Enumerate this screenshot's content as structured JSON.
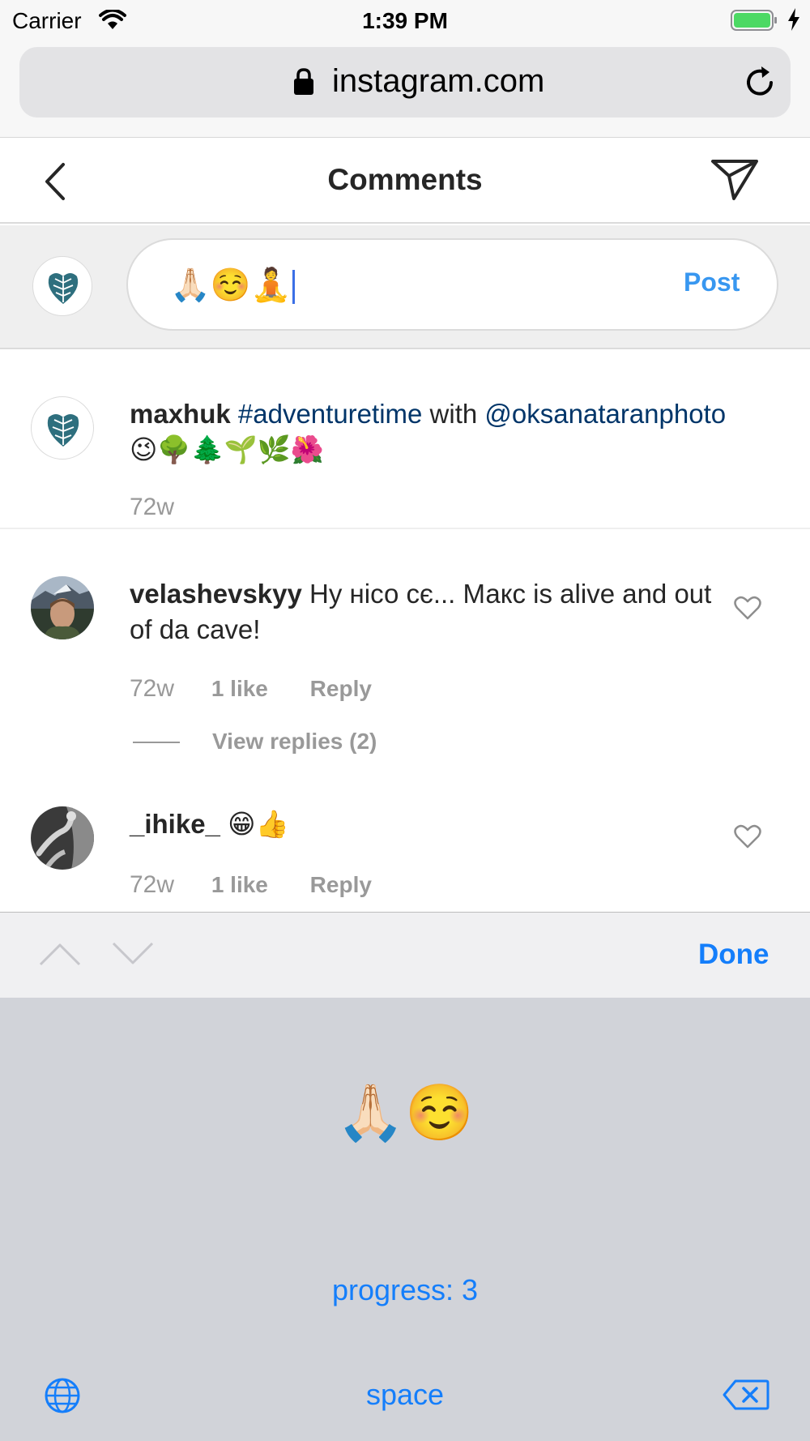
{
  "status_bar": {
    "carrier": "Carrier",
    "time": "1:39 PM",
    "icons": [
      "wifi-icon",
      "battery-icon",
      "charging-bolt-icon"
    ]
  },
  "browser": {
    "url": "instagram.com",
    "icons": [
      "lock-icon",
      "reload-icon"
    ]
  },
  "header": {
    "title": "Comments",
    "icons": [
      "back-chevron-icon",
      "send-direct-icon"
    ]
  },
  "comment_input": {
    "value": "🙏🏻☺️🧘",
    "post_label": "Post"
  },
  "caption": {
    "username": "maxhuk",
    "hashtag": "#adventuretime",
    "word_with": "with",
    "mention": "@oksanataranphoto",
    "emojis": "😉🌳🌲🌱🌿🌺",
    "time": "72w"
  },
  "comments": [
    {
      "username": "velashevskyy",
      "text": "Ну нісо сє... Макс is alive and out of da cave!",
      "time": "72w",
      "likes": "1 like",
      "reply": "Reply",
      "view_replies": "View replies (2)"
    },
    {
      "username": "_ihike_",
      "text": "😁👍",
      "time": "72w",
      "likes": "1 like",
      "reply": "Reply"
    }
  ],
  "accessory_bar": {
    "done_label": "Done",
    "icons": [
      "chevron-up-icon",
      "chevron-down-icon"
    ]
  },
  "keyboard": {
    "emoji_preview": "🙏🏻☺️",
    "progress_text": "progress: 3",
    "space_label": "space",
    "icons": [
      "globe-icon",
      "delete-icon"
    ]
  },
  "colors": {
    "link_blue": "#3897f0",
    "tag_navy": "#003569",
    "ios_blue": "#147efb",
    "meta_gray": "#999999"
  }
}
